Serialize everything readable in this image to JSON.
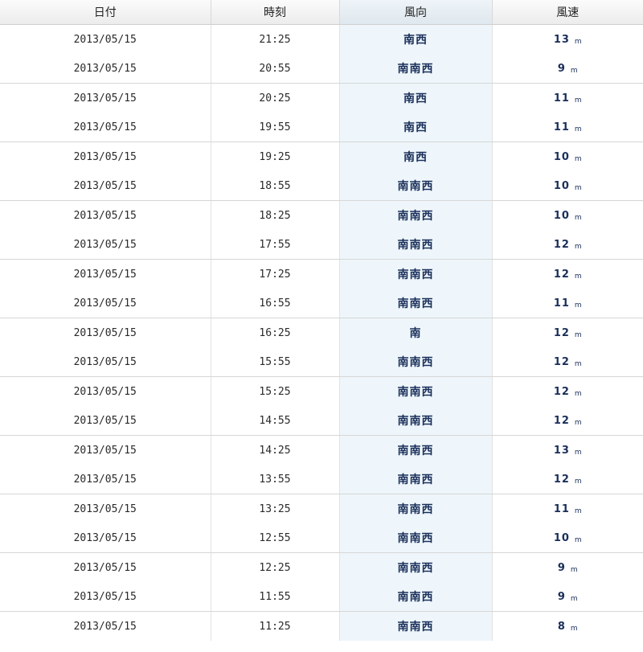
{
  "headers": {
    "date": "日付",
    "time": "時刻",
    "direction": "風向",
    "speed": "風速"
  },
  "colors": {
    "direction_bg": "#eef6fb",
    "value_text": "#1a2f5a"
  },
  "rows": [
    {
      "date": "2013/05/15",
      "time": "21:25",
      "direction": "南西",
      "speed": "13",
      "unit": "m"
    },
    {
      "date": "2013/05/15",
      "time": "20:55",
      "direction": "南南西",
      "speed": "9",
      "unit": "m"
    },
    {
      "date": "2013/05/15",
      "time": "20:25",
      "direction": "南西",
      "speed": "11",
      "unit": "m"
    },
    {
      "date": "2013/05/15",
      "time": "19:55",
      "direction": "南西",
      "speed": "11",
      "unit": "m"
    },
    {
      "date": "2013/05/15",
      "time": "19:25",
      "direction": "南西",
      "speed": "10",
      "unit": "m"
    },
    {
      "date": "2013/05/15",
      "time": "18:55",
      "direction": "南南西",
      "speed": "10",
      "unit": "m"
    },
    {
      "date": "2013/05/15",
      "time": "18:25",
      "direction": "南南西",
      "speed": "10",
      "unit": "m"
    },
    {
      "date": "2013/05/15",
      "time": "17:55",
      "direction": "南南西",
      "speed": "12",
      "unit": "m"
    },
    {
      "date": "2013/05/15",
      "time": "17:25",
      "direction": "南南西",
      "speed": "12",
      "unit": "m"
    },
    {
      "date": "2013/05/15",
      "time": "16:55",
      "direction": "南南西",
      "speed": "11",
      "unit": "m"
    },
    {
      "date": "2013/05/15",
      "time": "16:25",
      "direction": "南",
      "speed": "12",
      "unit": "m"
    },
    {
      "date": "2013/05/15",
      "time": "15:55",
      "direction": "南南西",
      "speed": "12",
      "unit": "m"
    },
    {
      "date": "2013/05/15",
      "time": "15:25",
      "direction": "南南西",
      "speed": "12",
      "unit": "m"
    },
    {
      "date": "2013/05/15",
      "time": "14:55",
      "direction": "南南西",
      "speed": "12",
      "unit": "m"
    },
    {
      "date": "2013/05/15",
      "time": "14:25",
      "direction": "南南西",
      "speed": "13",
      "unit": "m"
    },
    {
      "date": "2013/05/15",
      "time": "13:55",
      "direction": "南南西",
      "speed": "12",
      "unit": "m"
    },
    {
      "date": "2013/05/15",
      "time": "13:25",
      "direction": "南南西",
      "speed": "11",
      "unit": "m"
    },
    {
      "date": "2013/05/15",
      "time": "12:55",
      "direction": "南南西",
      "speed": "10",
      "unit": "m"
    },
    {
      "date": "2013/05/15",
      "time": "12:25",
      "direction": "南南西",
      "speed": "9",
      "unit": "m"
    },
    {
      "date": "2013/05/15",
      "time": "11:55",
      "direction": "南南西",
      "speed": "9",
      "unit": "m"
    },
    {
      "date": "2013/05/15",
      "time": "11:25",
      "direction": "南南西",
      "speed": "8",
      "unit": "m"
    }
  ]
}
